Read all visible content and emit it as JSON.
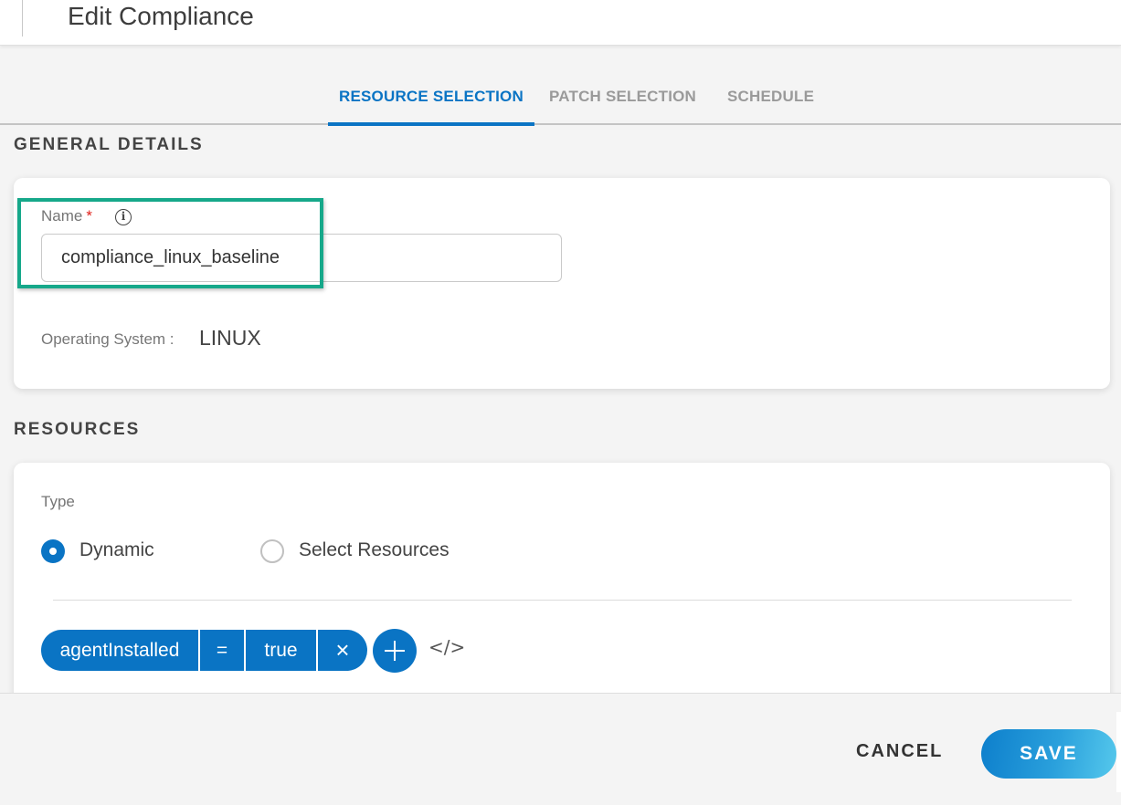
{
  "header": {
    "title": "Edit Compliance"
  },
  "tabs": [
    {
      "label": "RESOURCE SELECTION",
      "active": true
    },
    {
      "label": "PATCH SELECTION",
      "active": false
    },
    {
      "label": "SCHEDULE",
      "active": false
    }
  ],
  "general_details": {
    "section_title": "GENERAL DETAILS",
    "name_label": "Name",
    "required_mark": "*",
    "info_icon": "i",
    "name_value": "compliance_linux_baseline",
    "os_label": "Operating System :",
    "os_value": "LINUX"
  },
  "resources": {
    "section_title": "RESOURCES",
    "type_label": "Type",
    "radios": [
      {
        "label": "Dynamic",
        "checked": true
      },
      {
        "label": "Select Resources",
        "checked": false
      }
    ],
    "filter": {
      "field": "agentInstalled",
      "operator": "=",
      "value": "true",
      "remove_icon": "×"
    },
    "code_icon": "</>"
  },
  "footer": {
    "cancel_label": "CANCEL",
    "save_label": "SAVE"
  },
  "colors": {
    "accent": "#0a74c4",
    "highlight": "#16a88a",
    "required": "#e0201a"
  }
}
